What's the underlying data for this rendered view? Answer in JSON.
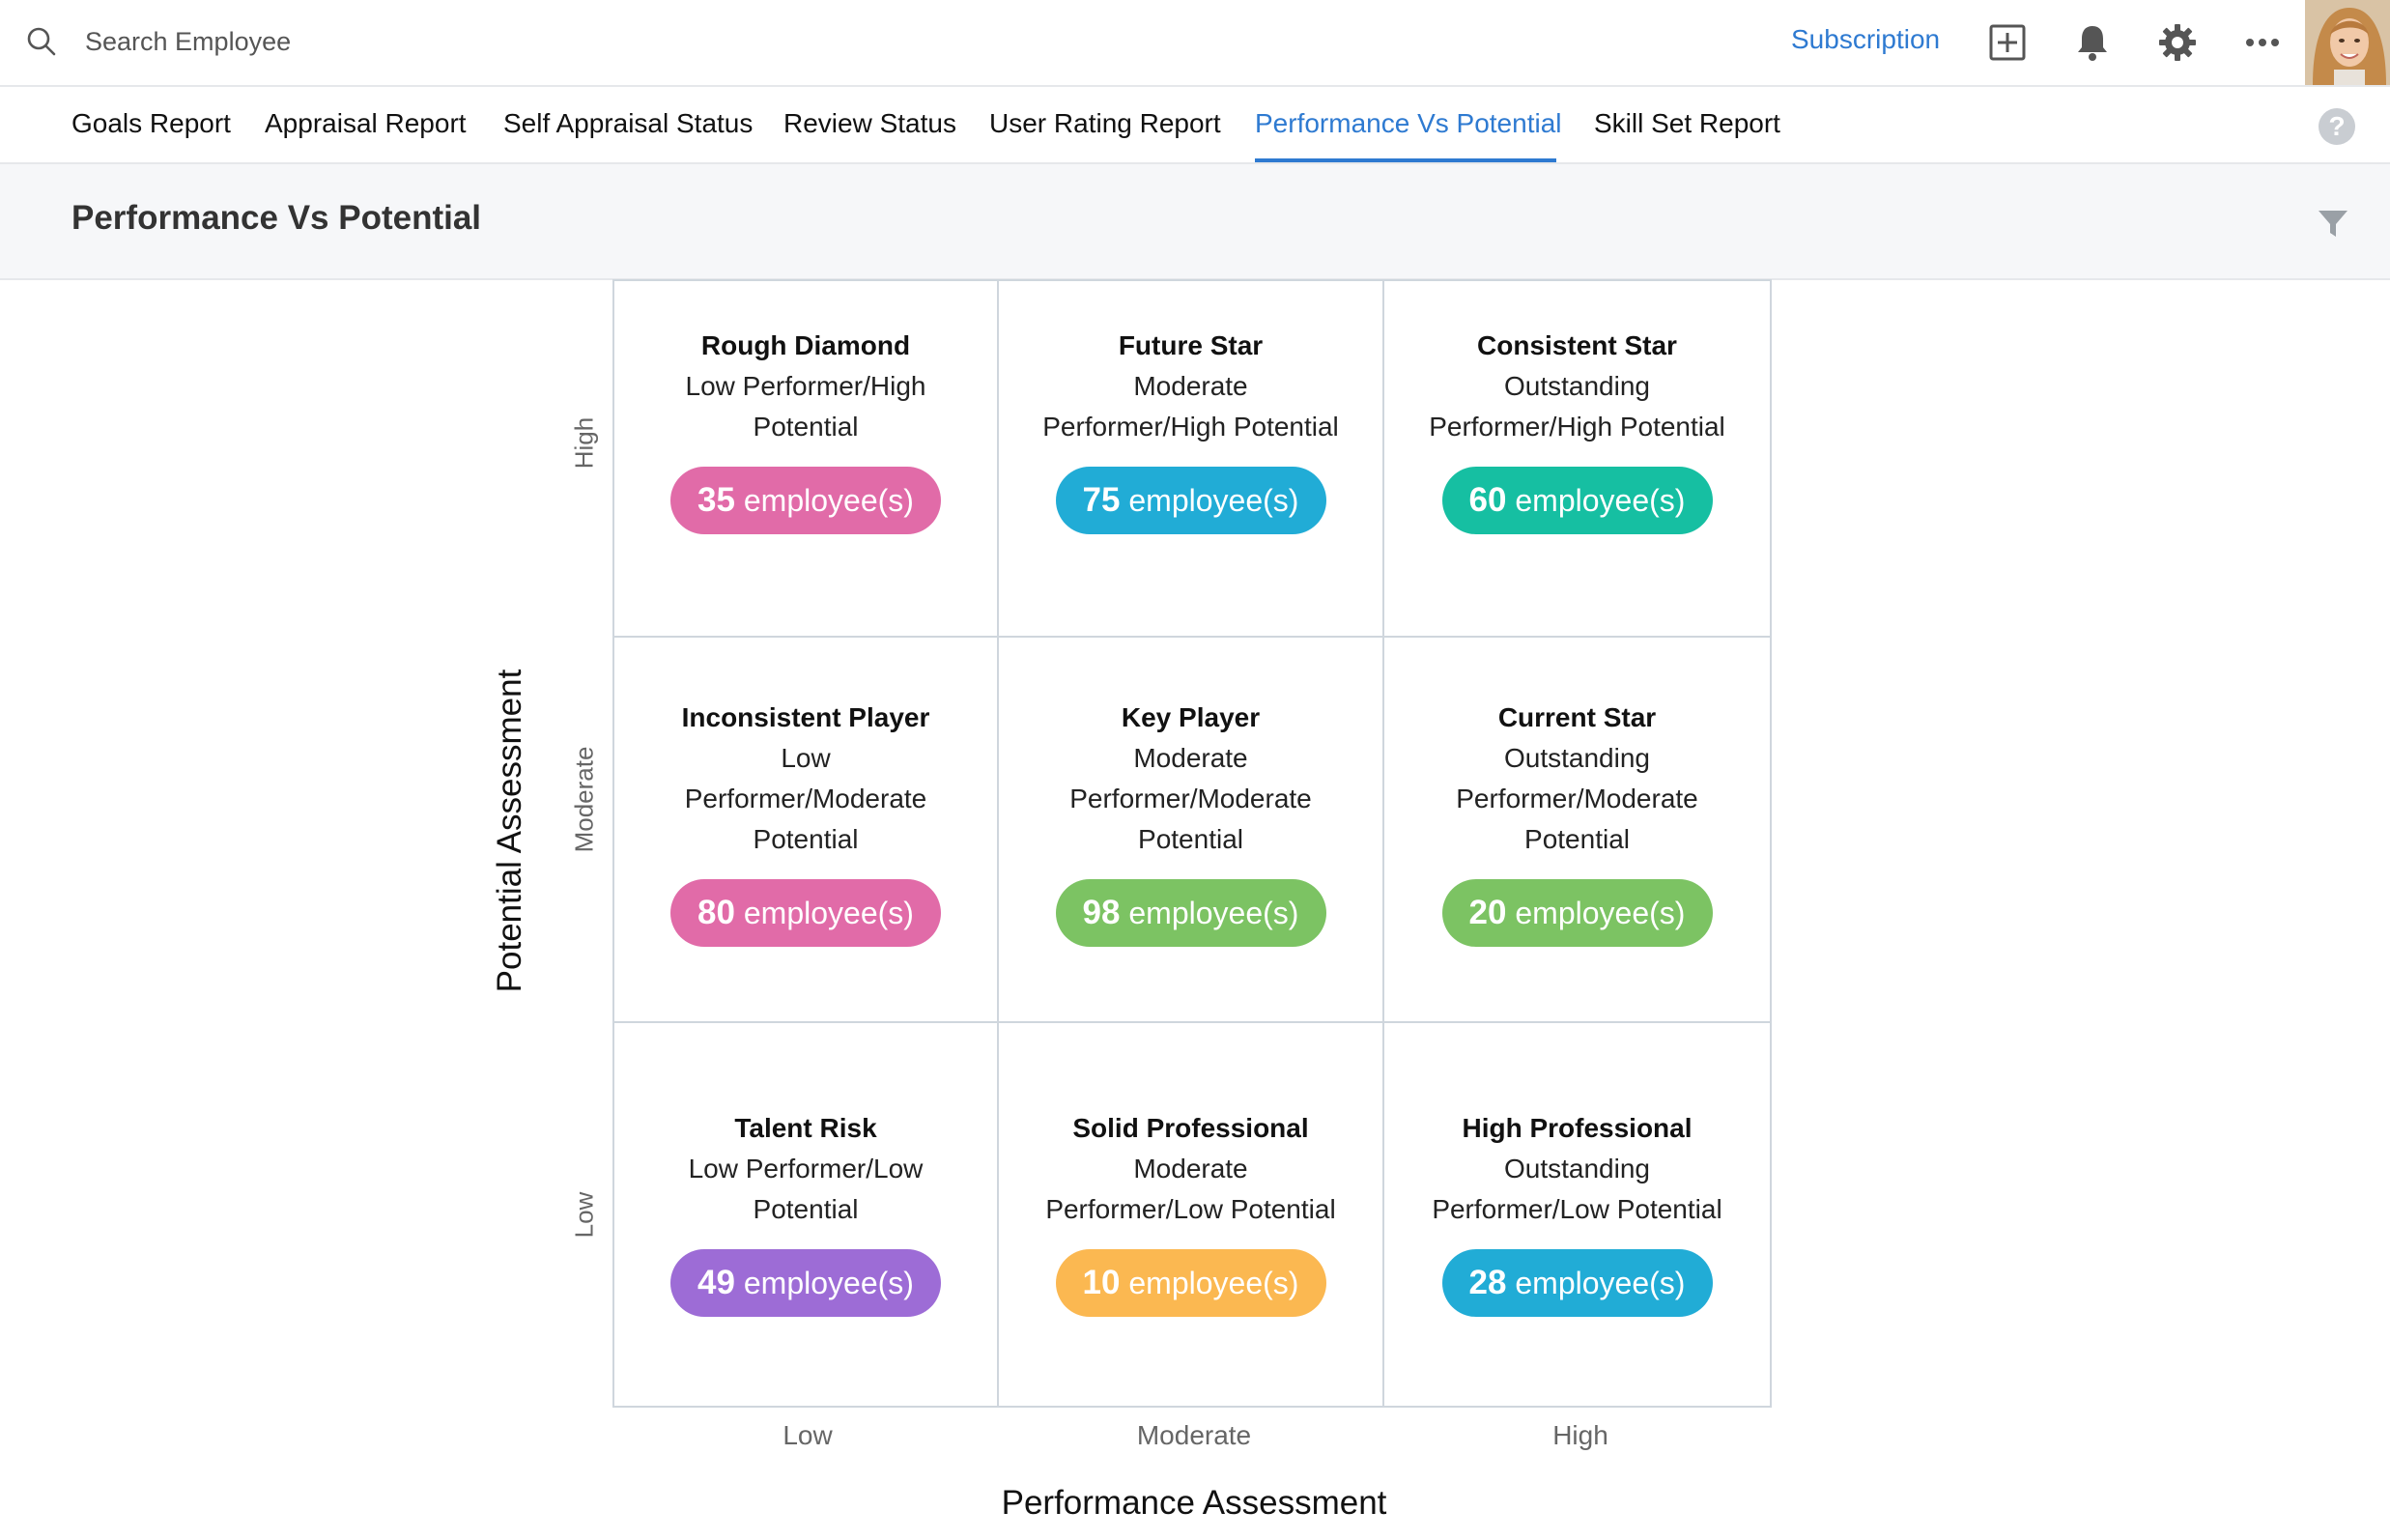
{
  "search": {
    "placeholder": "Search Employee"
  },
  "topbar": {
    "subscription_label": "Subscription",
    "icons": [
      "add-icon",
      "bell-icon",
      "gear-icon",
      "more-icon"
    ]
  },
  "tabs": [
    {
      "label": "Goals Report",
      "active": false
    },
    {
      "label": "Appraisal Report",
      "active": false
    },
    {
      "label": "Self Appraisal Status",
      "active": false
    },
    {
      "label": "Review Status",
      "active": false
    },
    {
      "label": "User Rating Report",
      "active": false
    },
    {
      "label": "Performance Vs Potential",
      "active": true
    },
    {
      "label": "Skill Set Report",
      "active": false
    }
  ],
  "help_label": "?",
  "page_title": "Performance Vs Potential",
  "matrix": {
    "y_axis_title": "Potential Assessment",
    "x_axis_title": "Performance Assessment",
    "y_levels": [
      "High",
      "Moderate",
      "Low"
    ],
    "x_levels": [
      "Low",
      "Moderate",
      "High"
    ],
    "count_suffix": "employee(s)",
    "rows": [
      [
        {
          "title": "Rough Diamond",
          "desc_lines": [
            "Low Performer/High",
            "Potential"
          ],
          "count": "35",
          "color": "#e16ba8"
        },
        {
          "title": "Future Star",
          "desc_lines": [
            "Moderate",
            "Performer/High Potential"
          ],
          "count": "75",
          "color": "#21acd6"
        },
        {
          "title": "Consistent Star",
          "desc_lines": [
            "Outstanding",
            "Performer/High Potential"
          ],
          "count": "60",
          "color": "#16bfa2"
        }
      ],
      [
        {
          "title": "Inconsistent Player",
          "desc_lines": [
            "Low",
            "Performer/Moderate",
            "Potential"
          ],
          "count": "80",
          "color": "#e16ba8"
        },
        {
          "title": "Key Player",
          "desc_lines": [
            "Moderate",
            "Performer/Moderate",
            "Potential"
          ],
          "count": "98",
          "color": "#7cc363"
        },
        {
          "title": "Current Star",
          "desc_lines": [
            "Outstanding",
            "Performer/Moderate",
            "Potential"
          ],
          "count": "20",
          "color": "#7cc363"
        }
      ],
      [
        {
          "title": "Talent Risk",
          "desc_lines": [
            "Low Performer/Low",
            "Potential"
          ],
          "count": "49",
          "color": "#9d6cd6"
        },
        {
          "title": "Solid Professional",
          "desc_lines": [
            "Moderate",
            "Performer/Low Potential"
          ],
          "count": "10",
          "color": "#fbb851"
        },
        {
          "title": "High Professional",
          "desc_lines": [
            "Outstanding",
            "Performer/Low Potential"
          ],
          "count": "28",
          "color": "#21acd6"
        }
      ]
    ]
  }
}
